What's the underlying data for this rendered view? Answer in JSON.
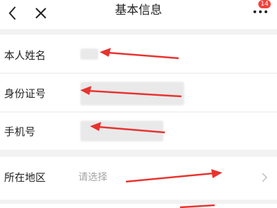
{
  "header": {
    "title": "基本信息",
    "back_icon": "chevron-left-icon",
    "close_icon": "close-icon",
    "more_icon": "more-dots-icon",
    "badge_count": "14"
  },
  "form": {
    "rows": [
      {
        "label": "本人姓名"
      },
      {
        "label": "身份证号"
      },
      {
        "label": "手机号"
      }
    ],
    "region": {
      "label": "所在地区",
      "placeholder": "请选择",
      "chevron_icon": "chevron-right-icon"
    }
  },
  "annotation": {
    "arrow_color": "#e8332f"
  }
}
